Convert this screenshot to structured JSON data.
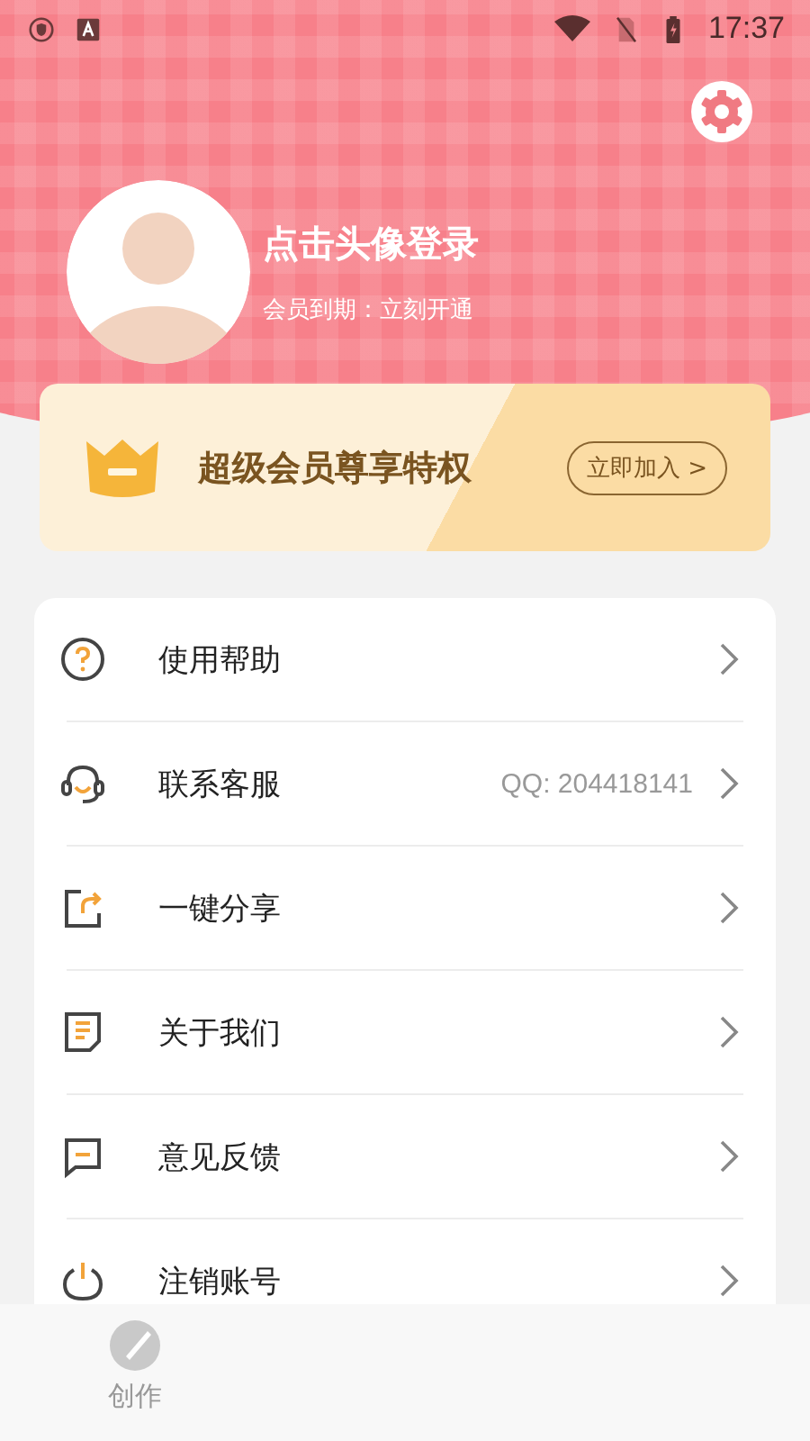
{
  "status_bar": {
    "time": "17:37"
  },
  "profile": {
    "title": "点击头像登录",
    "subtitle": "会员到期：立刻开通"
  },
  "vip_banner": {
    "title": "超级会员尊享特权",
    "button": "立即加入 >"
  },
  "menu": [
    {
      "label": "使用帮助"
    },
    {
      "label": "联系客服",
      "detail": "QQ: 204418141"
    },
    {
      "label": "一键分享"
    },
    {
      "label": "关于我们"
    },
    {
      "label": "意见反馈"
    },
    {
      "label": "注销账号"
    }
  ],
  "bottom_nav": [
    {
      "label": "创作",
      "selected": false
    }
  ]
}
